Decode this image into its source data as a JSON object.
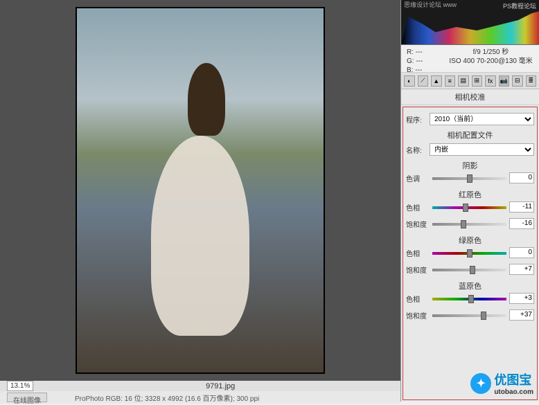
{
  "histogram": {
    "top_text": "思缘设计论坛 www",
    "top_right": "PS教程论坛"
  },
  "exif": {
    "r": "R: ---",
    "g": "G: ---",
    "b": "B: ---",
    "aperture": "f/9  1/250 秒",
    "iso": "ISO 400  70-200@130 毫米"
  },
  "panel": {
    "title": "相机校准",
    "process_label": "程序:",
    "process_value": "2010（当前）",
    "profile_header": "相机配置文件",
    "name_label": "名称:",
    "name_value": "内嵌",
    "shadow": {
      "header": "阴影",
      "tint_label": "色调",
      "tint_value": "0"
    },
    "red": {
      "header": "红原色",
      "hue_label": "色相",
      "hue_value": "-11",
      "sat_label": "饱和度",
      "sat_value": "-16"
    },
    "green": {
      "header": "绿原色",
      "hue_label": "色相",
      "hue_value": "0",
      "sat_label": "饱和度",
      "sat_value": "+7"
    },
    "blue": {
      "header": "蓝原色",
      "hue_label": "色相",
      "hue_value": "+3",
      "sat_label": "饱和度",
      "sat_value": "+37"
    }
  },
  "bottom": {
    "zoom": "13.1%",
    "filename": "9791.jpg"
  },
  "status": {
    "tab": "在线图像",
    "info": "ProPhoto RGB: 16 位; 3328 x 4992 (16.6 百万像素); 300 ppi"
  },
  "watermark": {
    "text": "优图宝",
    "url": "utobao.com"
  }
}
